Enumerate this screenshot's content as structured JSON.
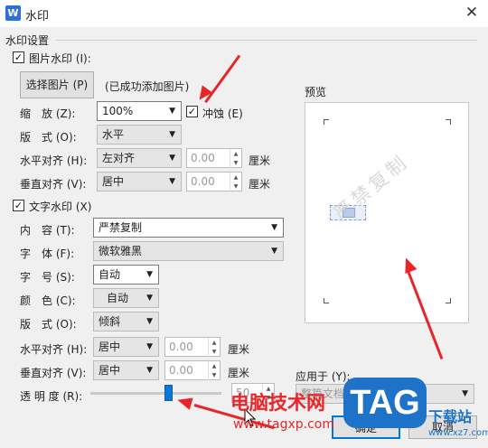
{
  "window": {
    "title": "水印",
    "close": "✕",
    "app_icon": "W"
  },
  "section_label": "水印设置",
  "picture": {
    "checkbox_label": "图片水印 (I):",
    "checked": true,
    "select_btn": "选择图片 (P)",
    "status": "(已成功添加图片)",
    "scale_label": "缩　放 (Z):",
    "scale_value": "100%",
    "washout_label": "冲蚀 (E)",
    "washout_checked": true,
    "layout_label": "版　式 (O):",
    "layout_value": "水平",
    "halign_label": "水平对齐 (H):",
    "halign_value": "左对齐",
    "halign_offset": "0.00",
    "halign_unit": "厘米",
    "valign_label": "垂直对齐 (V):",
    "valign_value": "居中",
    "valign_offset": "0.00",
    "valign_unit": "厘米"
  },
  "text": {
    "checkbox_label": "文字水印 (X)",
    "checked": true,
    "content_label": "内　容 (T):",
    "content_value": "严禁复制",
    "font_label": "字　体 (F):",
    "font_value": "微软雅黑",
    "size_label": "字　号 (S):",
    "size_value": "自动",
    "color_label": "颜　色 (C):",
    "color_value": "自动",
    "layout_label": "版　式 (O):",
    "layout_value": "倾斜",
    "halign_label": "水平对齐 (H):",
    "halign_value": "居中",
    "halign_offset": "0.00",
    "halign_unit": "厘米",
    "valign_label": "垂直对齐 (V):",
    "valign_value": "居中",
    "valign_offset": "0.00",
    "valign_unit": "厘米",
    "transparency_label": "透 明 度 (R):",
    "transparency_level": 0.6,
    "transparency_value": "50"
  },
  "preview": {
    "label": "预览",
    "watermark_text": "严禁复制"
  },
  "apply": {
    "label": "应用于 (Y):",
    "value": "整篇文档"
  },
  "buttons": {
    "ok": "确定",
    "cancel": "取消"
  },
  "overlay": {
    "site_name": "电脑技术网",
    "site_url": "www.tagxp.com",
    "logo_text": "TAG",
    "logo_sub": "下载站",
    "logo_url": "www.xz7.com"
  },
  "colors": {
    "accent": "#0b76d4",
    "arrow": "#e8262a",
    "logo_blue": "#1e73c8"
  }
}
